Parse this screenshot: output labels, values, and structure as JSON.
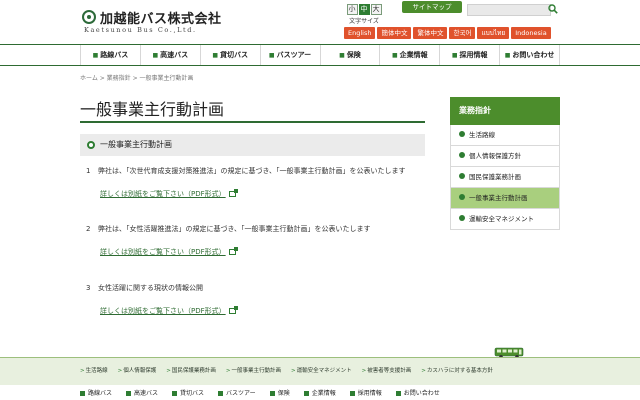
{
  "header": {
    "logo_ja": "加越能バス株式会社",
    "logo_en": "Kaetsunou Bus Co.,Ltd.",
    "fontsize": {
      "small": "小",
      "medium": "中",
      "large": "大",
      "label": "文字サイズ",
      "selected": "中"
    },
    "sitemap": "サイトマップ",
    "search_placeholder": "",
    "languages": [
      "English",
      "簡体中文",
      "繁体中文",
      "한국어",
      "แบบไทย",
      "Indonesia"
    ]
  },
  "nav": {
    "items": [
      "路線バス",
      "高速バス",
      "貸切バス",
      "バスツアー",
      "保険",
      "企業情報",
      "採用情報",
      "お問い合わせ"
    ]
  },
  "breadcrumb": "ホーム > 業務指針 > 一般事業主行動計画",
  "main": {
    "title": "一般事業主行動計画",
    "section_title": "一般事業主行動計画",
    "items": [
      {
        "num": "1",
        "text": "弊社は、「次世代育成支援対策推進法」の規定に基づき、「一般事業主行動計画」を公表いたします",
        "link": "詳しくは別紙をご覧下さい（PDF形式）"
      },
      {
        "num": "2",
        "text": "弊社は、「女性活躍推進法」の規定に基づき、「一般事業主行動計画」を公表いたします",
        "link": "詳しくは別紙をご覧下さい（PDF形式）"
      },
      {
        "num": "3",
        "text": "女性活躍に関する現状の情報公開",
        "link": "詳しくは別紙をご覧下さい（PDF形式）"
      }
    ]
  },
  "sidebar": {
    "heading": "業務指針",
    "items": [
      "生活路線",
      "個人情報保護方針",
      "国民保護業務計画",
      "一般事業主行動計画",
      "運輸安全マネジメント"
    ],
    "active": "一般事業主行動計画"
  },
  "footer": {
    "links": [
      "生活路線",
      "個人情報保護",
      "国民保護業務計画",
      "一般事業主行動計画",
      "運輸安全マネジメント",
      "被害者等支援計画",
      "カスハラに対する基本方針"
    ],
    "nav": [
      "路線バス",
      "高速バス",
      "貸切バス",
      "バスツアー",
      "保険",
      "企業情報",
      "採用情報",
      "お問い合わせ"
    ]
  },
  "colors": {
    "brand_green": "#2e6b32",
    "accent_green": "#4c8d2c",
    "active_side": "#a9cf7e",
    "lang_orange": "#e0522c"
  }
}
